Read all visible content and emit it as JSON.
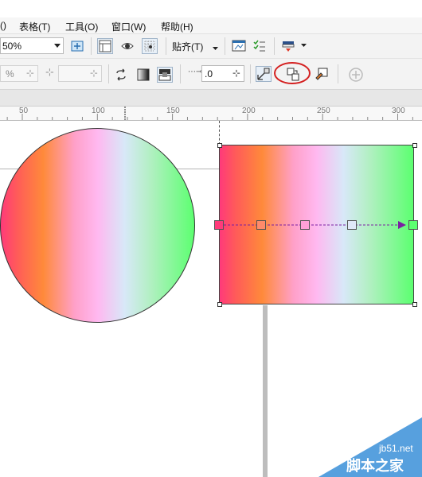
{
  "menu": {
    "items": [
      "()",
      "表格(T)",
      "工具(O)",
      "窗口(W)",
      "帮助(H)"
    ]
  },
  "toolbar1": {
    "zoom_value": "50%",
    "snap_label": "贴齐(T)"
  },
  "toolbar2": {
    "percent_value": "%",
    "nudge_value": ".0"
  },
  "ruler": {
    "labels": [
      "50",
      "100",
      "150",
      "200",
      "250",
      "300"
    ]
  },
  "watermark": {
    "site": "jb51.net",
    "name": "脚本之家"
  },
  "colors": {
    "gradient_start": "#ff3a7a",
    "gradient_end": "#5cff70",
    "interactive_line": "#7a1fa2",
    "highlight_circle": "#d42020"
  },
  "icons": [
    "dropdown-arrow-icon",
    "zoom-fit-icon",
    "page-layout-icon",
    "view-eye-icon",
    "grid-snap-icon",
    "chart-window-icon",
    "checklist-icon",
    "launch-icon",
    "target-icon",
    "lock-icon",
    "transparency-icon",
    "color-mode-icon",
    "copy-fill-icon",
    "fill-edit-icon",
    "add-icon"
  ]
}
